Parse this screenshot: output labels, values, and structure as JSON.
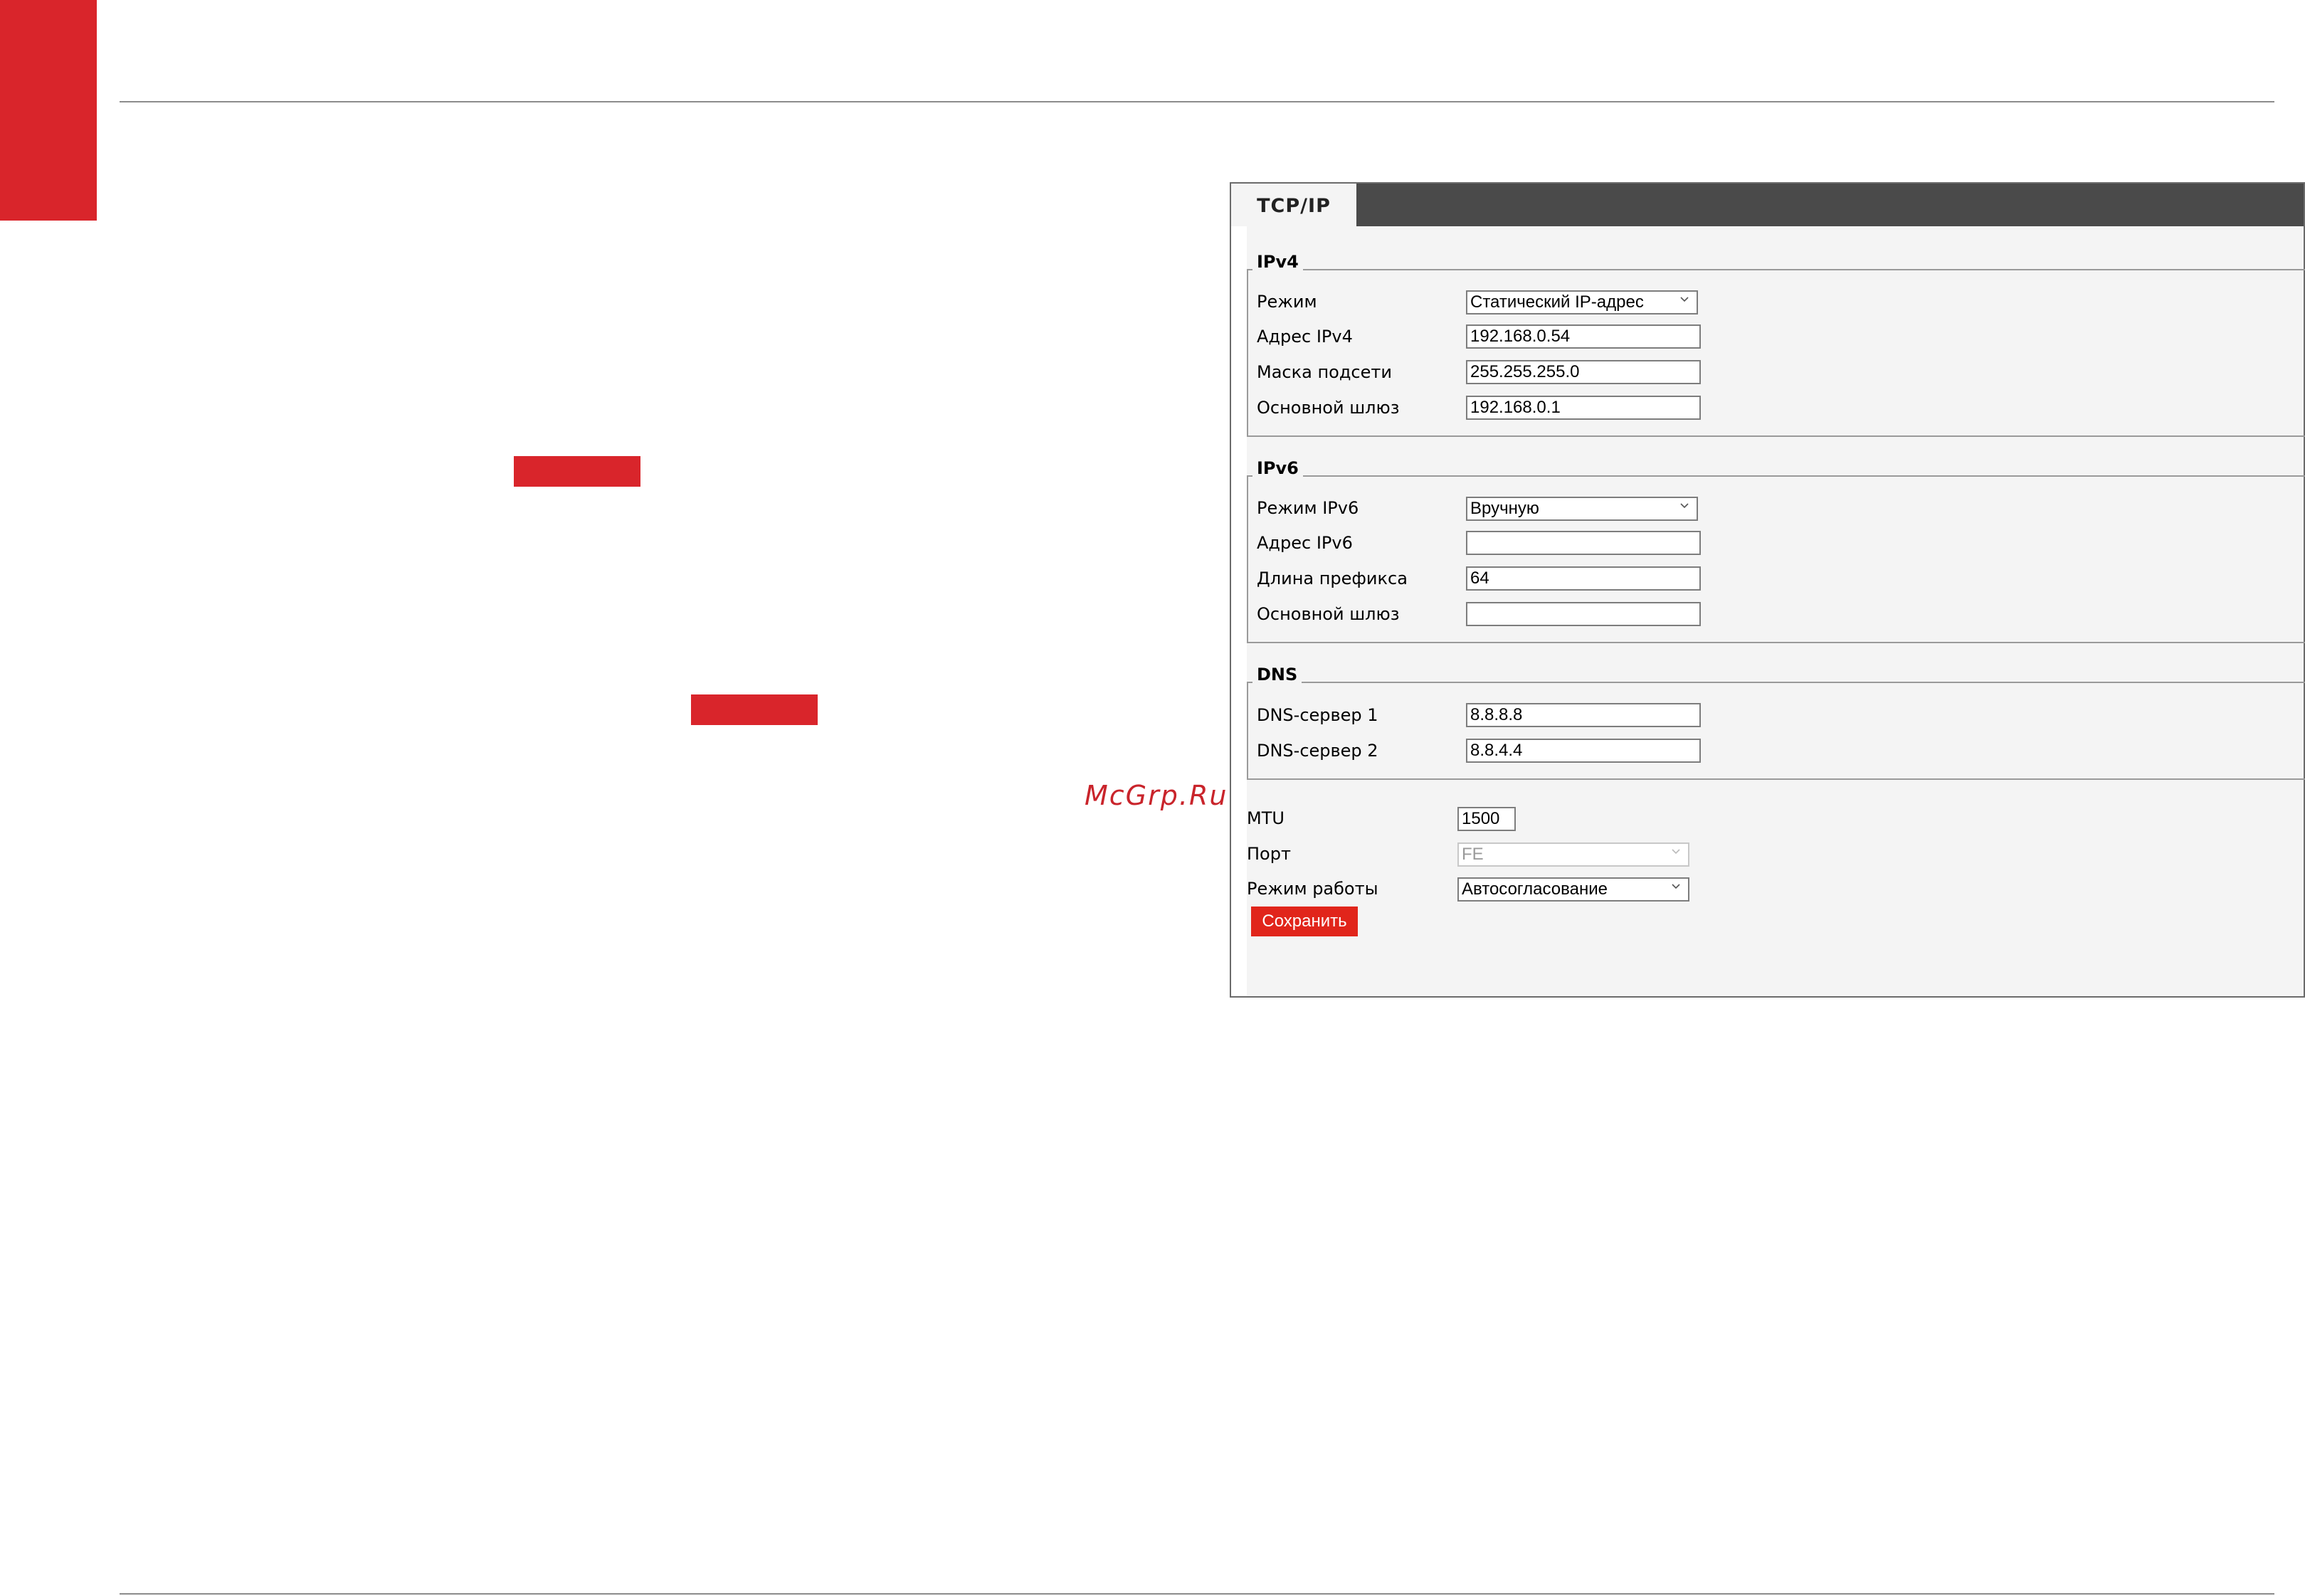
{
  "watermark": "McGrp.Ru",
  "panel": {
    "tab_label": "TCP/IP",
    "ipv4": {
      "legend": "IPv4",
      "mode_label": "Режим",
      "mode_value": "Статический IP-адрес",
      "address_label": "Адрес IPv4",
      "address_value": "192.168.0.54",
      "mask_label": "Маска подсети",
      "mask_value": "255.255.255.0",
      "gateway_label": "Основной шлюз",
      "gateway_value": "192.168.0.1"
    },
    "ipv6": {
      "legend": "IPv6",
      "mode_label": "Режим IPv6",
      "mode_value": "Вручную",
      "address_label": "Адрес IPv6",
      "address_value": "",
      "prefix_label": "Длина префикса",
      "prefix_value": "64",
      "gateway_label": "Основной шлюз",
      "gateway_value": ""
    },
    "dns": {
      "legend": "DNS",
      "dns1_label": "DNS-сервер 1",
      "dns1_value": "8.8.8.8",
      "dns2_label": "DNS-сервер 2",
      "dns2_value": "8.8.4.4"
    },
    "mtu_label": "MTU",
    "mtu_value": "1500",
    "port_label": "Порт",
    "port_value": "FE",
    "work_mode_label": "Режим работы",
    "work_mode_value": "Автосогласование",
    "save_label": "Сохранить"
  },
  "colors": {
    "accent_red": "#d9252b",
    "save_red": "#e1251b",
    "tab_strip": "#4a4a4a"
  }
}
